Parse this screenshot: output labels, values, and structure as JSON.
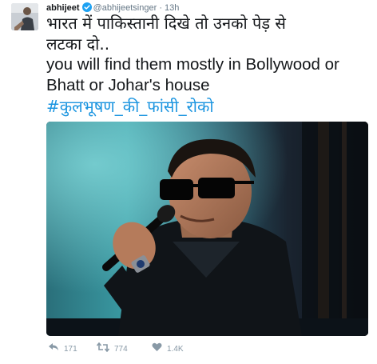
{
  "tweet": {
    "author": {
      "name": "abhijeet",
      "handle": "@abhijeetsinger",
      "verified": true,
      "avatar": "avatar-icon"
    },
    "separator": "·",
    "timestamp": "13h",
    "text": {
      "line1": "भारत में पाकिस्तानी दिखे तो उनको पेड़ से",
      "line2": "लटका दो..",
      "line3": "you will find them mostly in Bollywood or",
      "line4": "Bhatt or Johar's house",
      "hashtag": "#कुलभूषण_की_फांसी_रोको"
    },
    "media": {
      "kind": "photo"
    },
    "actions": {
      "reply": {
        "icon": "reply-icon",
        "count": "171"
      },
      "retweet": {
        "icon": "retweet-icon",
        "count": "774"
      },
      "like": {
        "icon": "heart-icon",
        "count": "1.4K"
      }
    },
    "colors": {
      "link": "#1b95e0",
      "meta": "#657786",
      "action": "#8899a6",
      "verified_badge": "#1da1f2"
    }
  }
}
